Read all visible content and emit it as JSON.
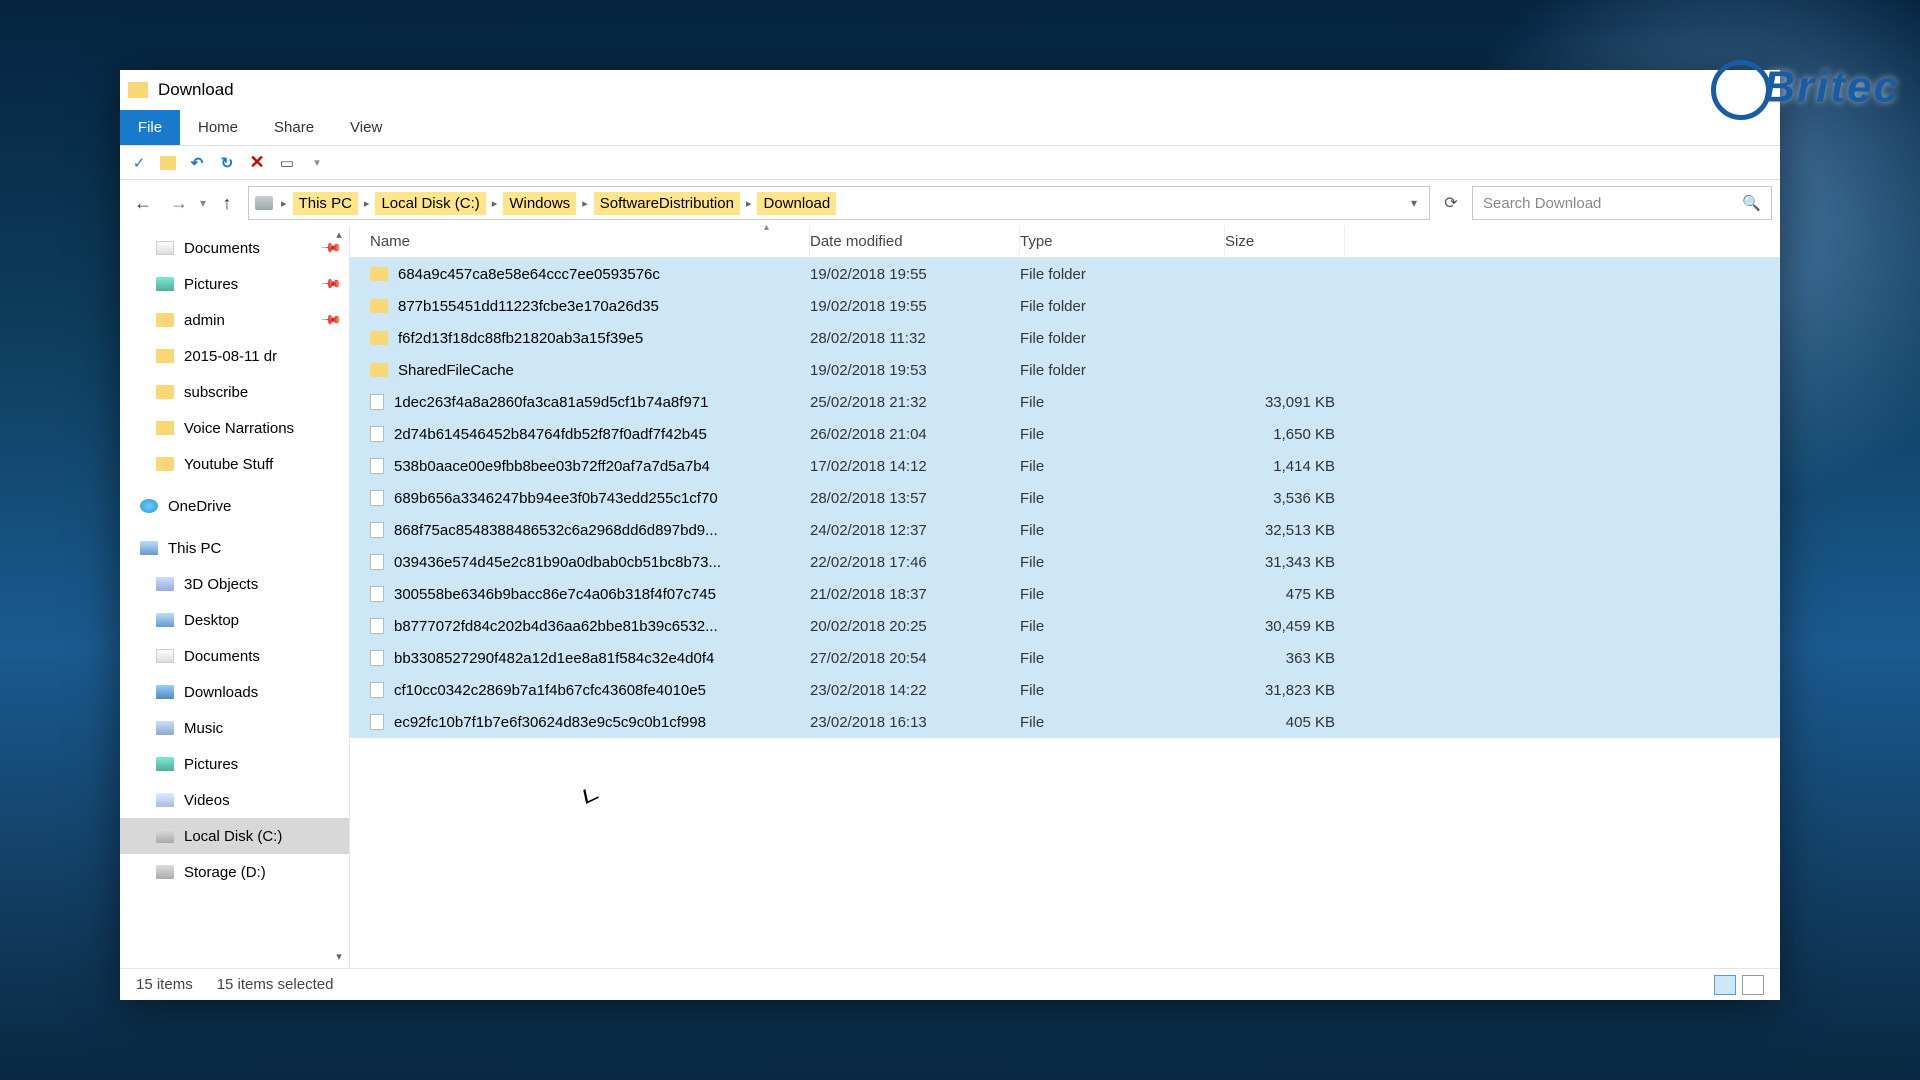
{
  "window": {
    "title": "Download"
  },
  "ribbon": {
    "file": "File",
    "home": "Home",
    "share": "Share",
    "view": "View"
  },
  "breadcrumb": {
    "segments": [
      "This PC",
      "Local Disk (C:)",
      "Windows",
      "SoftwareDistribution",
      "Download"
    ],
    "search_placeholder": "Search Download"
  },
  "nav_pane": {
    "quick": [
      {
        "label": "Documents",
        "icon": "doc",
        "pinned": true
      },
      {
        "label": "Pictures",
        "icon": "pic",
        "pinned": true
      },
      {
        "label": "admin",
        "icon": "folder",
        "pinned": true
      },
      {
        "label": "2015-08-11 dr",
        "icon": "folder"
      },
      {
        "label": "subscribe",
        "icon": "folder"
      },
      {
        "label": "Voice Narrations",
        "icon": "folder"
      },
      {
        "label": "Youtube Stuff",
        "icon": "folder"
      }
    ],
    "onedrive": "OneDrive",
    "thispc_label": "This PC",
    "thispc": [
      {
        "label": "3D Objects",
        "icon": "obj"
      },
      {
        "label": "Desktop",
        "icon": "pc"
      },
      {
        "label": "Documents",
        "icon": "doc"
      },
      {
        "label": "Downloads",
        "icon": "dl"
      },
      {
        "label": "Music",
        "icon": "music"
      },
      {
        "label": "Pictures",
        "icon": "pic"
      },
      {
        "label": "Videos",
        "icon": "vid"
      },
      {
        "label": "Local Disk (C:)",
        "icon": "drive",
        "selected": true
      },
      {
        "label": "Storage (D:)",
        "icon": "drive"
      }
    ]
  },
  "columns": {
    "name": "Name",
    "date": "Date modified",
    "type": "Type",
    "size": "Size"
  },
  "rows": [
    {
      "name": "684a9c457ca8e58e64ccc7ee0593576c",
      "date": "19/02/2018 19:55",
      "type": "File folder",
      "size": "",
      "kind": "folder"
    },
    {
      "name": "877b155451dd11223fcbe3e170a26d35",
      "date": "19/02/2018 19:55",
      "type": "File folder",
      "size": "",
      "kind": "folder"
    },
    {
      "name": "f6f2d13f18dc88fb21820ab3a15f39e5",
      "date": "28/02/2018 11:32",
      "type": "File folder",
      "size": "",
      "kind": "folder"
    },
    {
      "name": "SharedFileCache",
      "date": "19/02/2018 19:53",
      "type": "File folder",
      "size": "",
      "kind": "folder"
    },
    {
      "name": "1dec263f4a8a2860fa3ca81a59d5cf1b74a8f971",
      "date": "25/02/2018 21:32",
      "type": "File",
      "size": "33,091 KB",
      "kind": "file"
    },
    {
      "name": "2d74b614546452b84764fdb52f87f0adf7f42b45",
      "date": "26/02/2018 21:04",
      "type": "File",
      "size": "1,650 KB",
      "kind": "file"
    },
    {
      "name": "538b0aace00e9fbb8bee03b72ff20af7a7d5a7b4",
      "date": "17/02/2018 14:12",
      "type": "File",
      "size": "1,414 KB",
      "kind": "file"
    },
    {
      "name": "689b656a3346247bb94ee3f0b743edd255c1cf70",
      "date": "28/02/2018 13:57",
      "type": "File",
      "size": "3,536 KB",
      "kind": "file"
    },
    {
      "name": "868f75ac8548388486532c6a2968dd6d897bd9...",
      "date": "24/02/2018 12:37",
      "type": "File",
      "size": "32,513 KB",
      "kind": "file"
    },
    {
      "name": "039436e574d45e2c81b90a0dbab0cb51bc8b73...",
      "date": "22/02/2018 17:46",
      "type": "File",
      "size": "31,343 KB",
      "kind": "file"
    },
    {
      "name": "300558be6346b9bacc86e7c4a06b318f4f07c745",
      "date": "21/02/2018 18:37",
      "type": "File",
      "size": "475 KB",
      "kind": "file"
    },
    {
      "name": "b8777072fd84c202b4d36aa62bbe81b39c6532...",
      "date": "20/02/2018 20:25",
      "type": "File",
      "size": "30,459 KB",
      "kind": "file"
    },
    {
      "name": "bb3308527290f482a12d1ee8a81f584c32e4d0f4",
      "date": "27/02/2018 20:54",
      "type": "File",
      "size": "363 KB",
      "kind": "file"
    },
    {
      "name": "cf10cc0342c2869b7a1f4b67cfc43608fe4010e5",
      "date": "23/02/2018 14:22",
      "type": "File",
      "size": "31,823 KB",
      "kind": "file"
    },
    {
      "name": "ec92fc10b7f1b7e6f30624d83e9c5c9c0b1cf998",
      "date": "23/02/2018 16:13",
      "type": "File",
      "size": "405 KB",
      "kind": "file"
    }
  ],
  "status": {
    "items": "15 items",
    "selected": "15 items selected"
  },
  "brand": "Britec"
}
